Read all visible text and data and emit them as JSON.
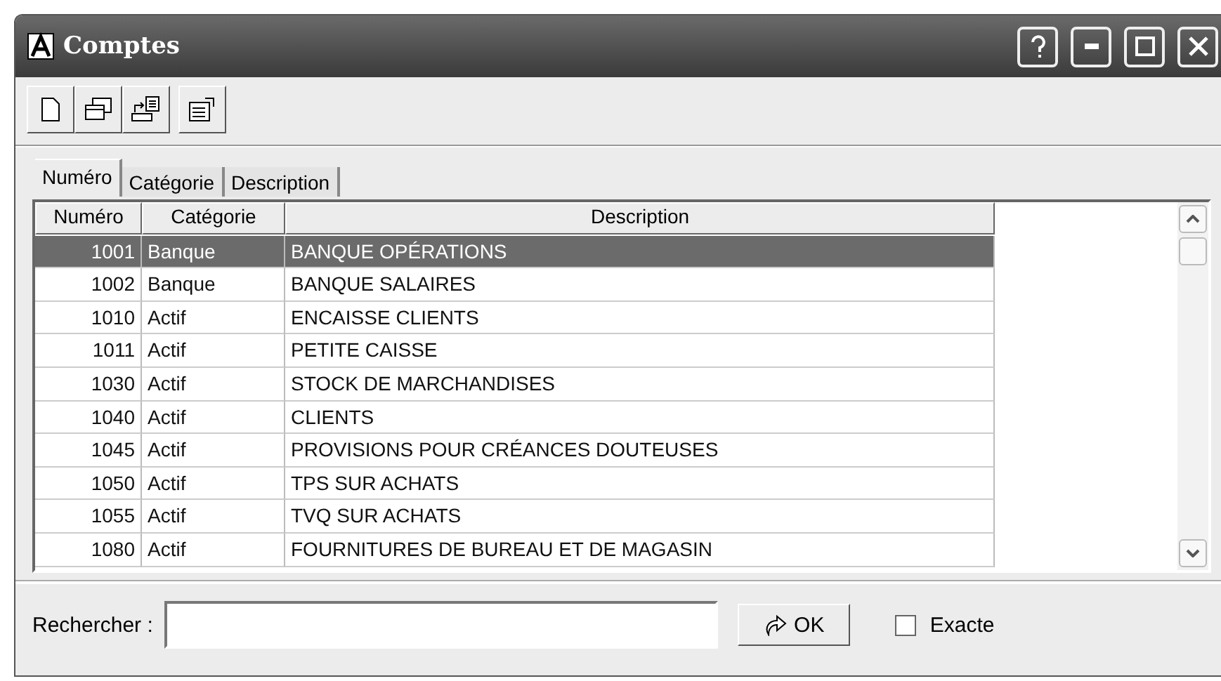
{
  "window": {
    "title": "Comptes"
  },
  "toolbar": {
    "buttons": [
      {
        "kind": "new"
      },
      {
        "kind": "windows"
      },
      {
        "kind": "export"
      },
      {
        "kind": "properties"
      }
    ]
  },
  "tabs": [
    {
      "label": "Numéro",
      "selected": true
    },
    {
      "label": "Catégorie",
      "selected": false
    },
    {
      "label": "Description",
      "selected": false
    }
  ],
  "table": {
    "columns": [
      "Numéro",
      "Catégorie",
      "Description"
    ],
    "rows": [
      {
        "number": "1001",
        "category": "Banque",
        "description": "BANQUE OPÉRATIONS",
        "selected": true
      },
      {
        "number": "1002",
        "category": "Banque",
        "description": "BANQUE SALAIRES",
        "selected": false
      },
      {
        "number": "1010",
        "category": "Actif",
        "description": "ENCAISSE CLIENTS",
        "selected": false
      },
      {
        "number": "1011",
        "category": "Actif",
        "description": "PETITE CAISSE",
        "selected": false
      },
      {
        "number": "1030",
        "category": "Actif",
        "description": "STOCK DE MARCHANDISES",
        "selected": false
      },
      {
        "number": "1040",
        "category": "Actif",
        "description": "CLIENTS",
        "selected": false
      },
      {
        "number": "1045",
        "category": "Actif",
        "description": "PROVISIONS POUR CRÉANCES DOUTEUSES",
        "selected": false
      },
      {
        "number": "1050",
        "category": "Actif",
        "description": "TPS SUR ACHATS",
        "selected": false
      },
      {
        "number": "1055",
        "category": "Actif",
        "description": "TVQ SUR ACHATS",
        "selected": false
      },
      {
        "number": "1080",
        "category": "Actif",
        "description": "FOURNITURES DE BUREAU ET DE MAGASIN",
        "selected": false
      }
    ]
  },
  "search": {
    "label": "Rechercher :",
    "ok": "OK",
    "exact": {
      "label": "Exacte",
      "checked": false
    }
  }
}
